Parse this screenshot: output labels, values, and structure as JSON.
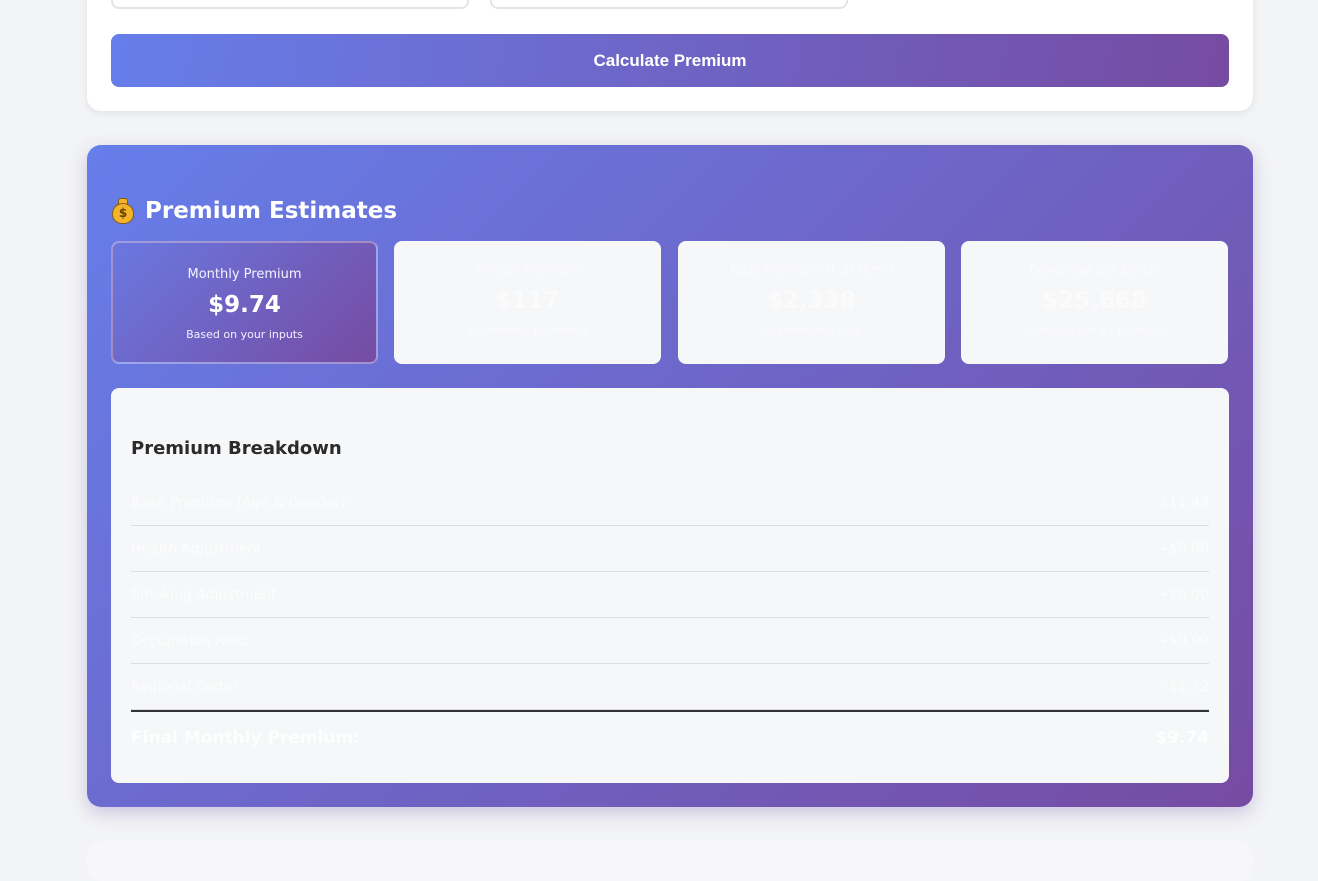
{
  "form": {
    "calculate_label": "Calculate Premium"
  },
  "results": {
    "title": "Premium Estimates",
    "title_icon": "money-bag-icon",
    "cards": [
      {
        "label": "Monthly Premium",
        "value": "$9.74",
        "sub": "Based on your inputs"
      },
      {
        "label": "Annual Premium",
        "value": "$117",
        "sub": "12 monthly payments"
      },
      {
        "label": "Total Premium (Full Term)",
        "value": "$2,338",
        "sub": "All premiums paid"
      },
      {
        "label": "Coverage per Dollar",
        "value": "$25,668",
        "sub": "Coverage per $1 premium"
      }
    ]
  },
  "breakdown": {
    "title": "Premium Breakdown",
    "rows": [
      {
        "label": "Base Premium (Age & Gender):",
        "value": "$11.48"
      },
      {
        "label": "Health Adjustment:",
        "value": "+$0.00"
      },
      {
        "label": "Smoking Adjustment:",
        "value": "+$0.00"
      },
      {
        "label": "Occupation Risk:",
        "value": "+$0.00"
      },
      {
        "label": "Regional Factor:",
        "value": "-$1.72"
      }
    ],
    "final_label": "Final Monthly Premium:",
    "final_value": "$9.74"
  },
  "colors": {
    "gradient_start": "#667eea",
    "gradient_end": "#764ba2"
  }
}
